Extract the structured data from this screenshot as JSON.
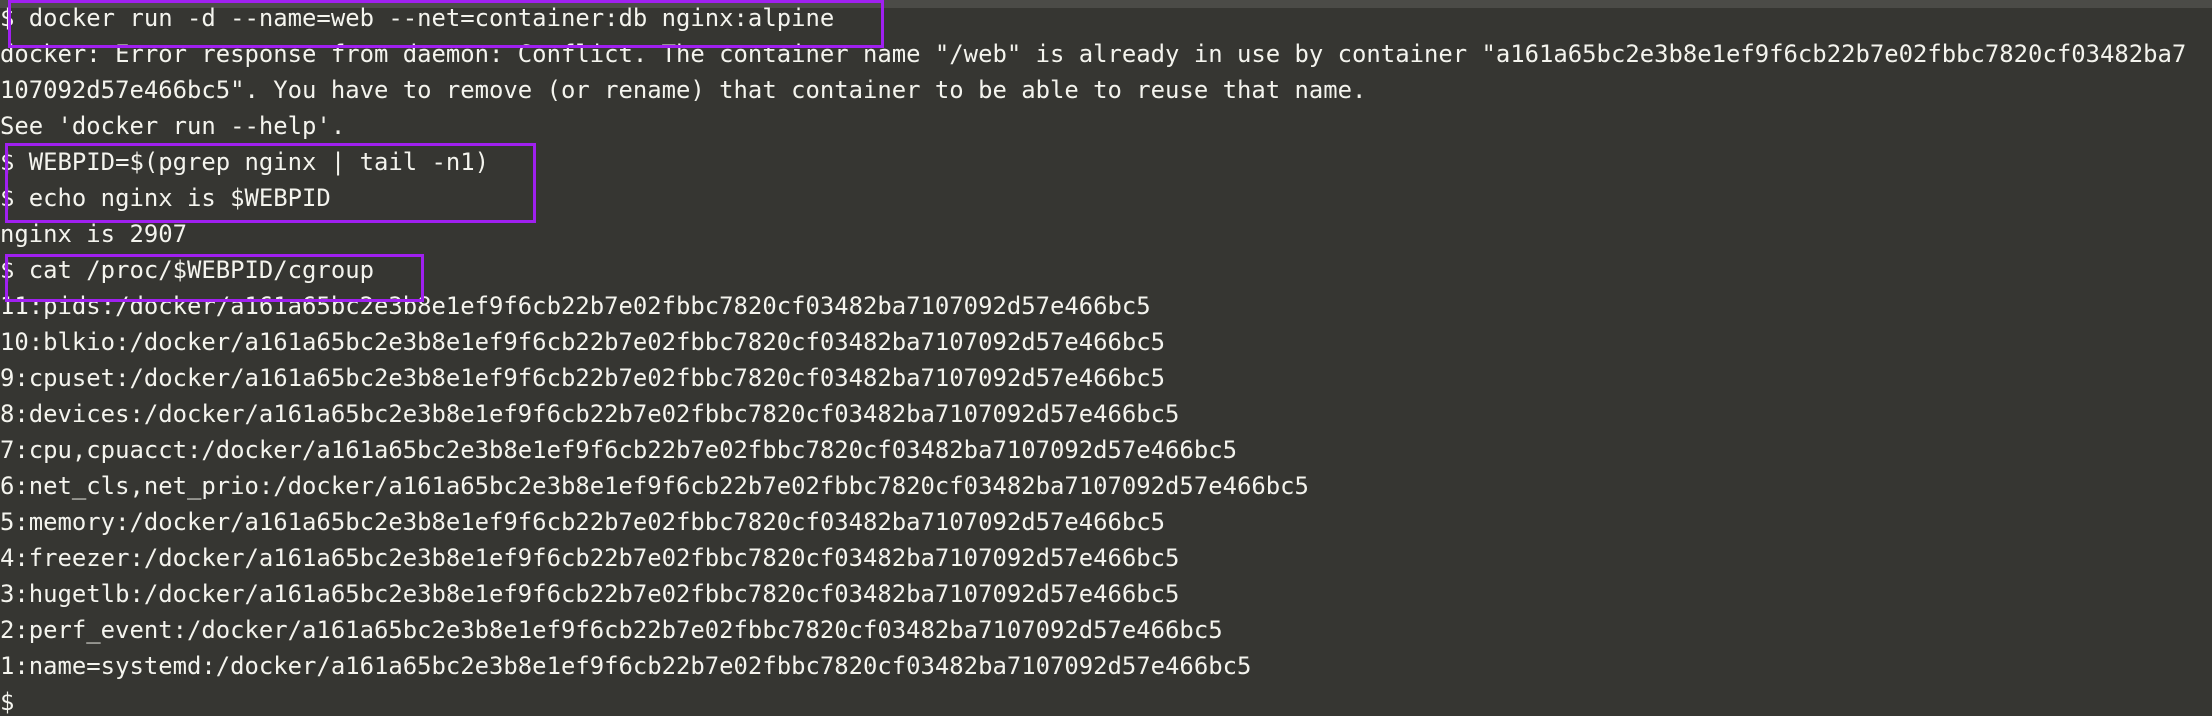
{
  "terminal": {
    "lines": [
      "$ docker run -d --name=web --net=container:db nginx:alpine",
      "docker: Error response from daemon: Conflict. The container name \"/web\" is already in use by container \"a161a65bc2e3b8e1ef9f6cb22b7e02fbbc7820cf03482ba7",
      "107092d57e466bc5\". You have to remove (or rename) that container to be able to reuse that name.",
      "See 'docker run --help'.",
      "$ WEBPID=$(pgrep nginx | tail -n1)",
      "$ echo nginx is $WEBPID",
      "nginx is 2907",
      "$ cat /proc/$WEBPID/cgroup",
      "11:pids:/docker/a161a65bc2e3b8e1ef9f6cb22b7e02fbbc7820cf03482ba7107092d57e466bc5",
      "10:blkio:/docker/a161a65bc2e3b8e1ef9f6cb22b7e02fbbc7820cf03482ba7107092d57e466bc5",
      "9:cpuset:/docker/a161a65bc2e3b8e1ef9f6cb22b7e02fbbc7820cf03482ba7107092d57e466bc5",
      "8:devices:/docker/a161a65bc2e3b8e1ef9f6cb22b7e02fbbc7820cf03482ba7107092d57e466bc5",
      "7:cpu,cpuacct:/docker/a161a65bc2e3b8e1ef9f6cb22b7e02fbbc7820cf03482ba7107092d57e466bc5",
      "6:net_cls,net_prio:/docker/a161a65bc2e3b8e1ef9f6cb22b7e02fbbc7820cf03482ba7107092d57e466bc5",
      "5:memory:/docker/a161a65bc2e3b8e1ef9f6cb22b7e02fbbc7820cf03482ba7107092d57e466bc5",
      "4:freezer:/docker/a161a65bc2e3b8e1ef9f6cb22b7e02fbbc7820cf03482ba7107092d57e466bc5",
      "3:hugetlb:/docker/a161a65bc2e3b8e1ef9f6cb22b7e02fbbc7820cf03482ba7107092d57e466bc5",
      "2:perf_event:/docker/a161a65bc2e3b8e1ef9f6cb22b7e02fbbc7820cf03482ba7107092d57e466bc5",
      "1:name=systemd:/docker/a161a65bc2e3b8e1ef9f6cb22b7e02fbbc7820cf03482ba7107092d57e466bc5",
      "$"
    ]
  },
  "colors": {
    "background": "#363632",
    "text": "#f4f4ee",
    "highlight_box": "#a020f0"
  }
}
